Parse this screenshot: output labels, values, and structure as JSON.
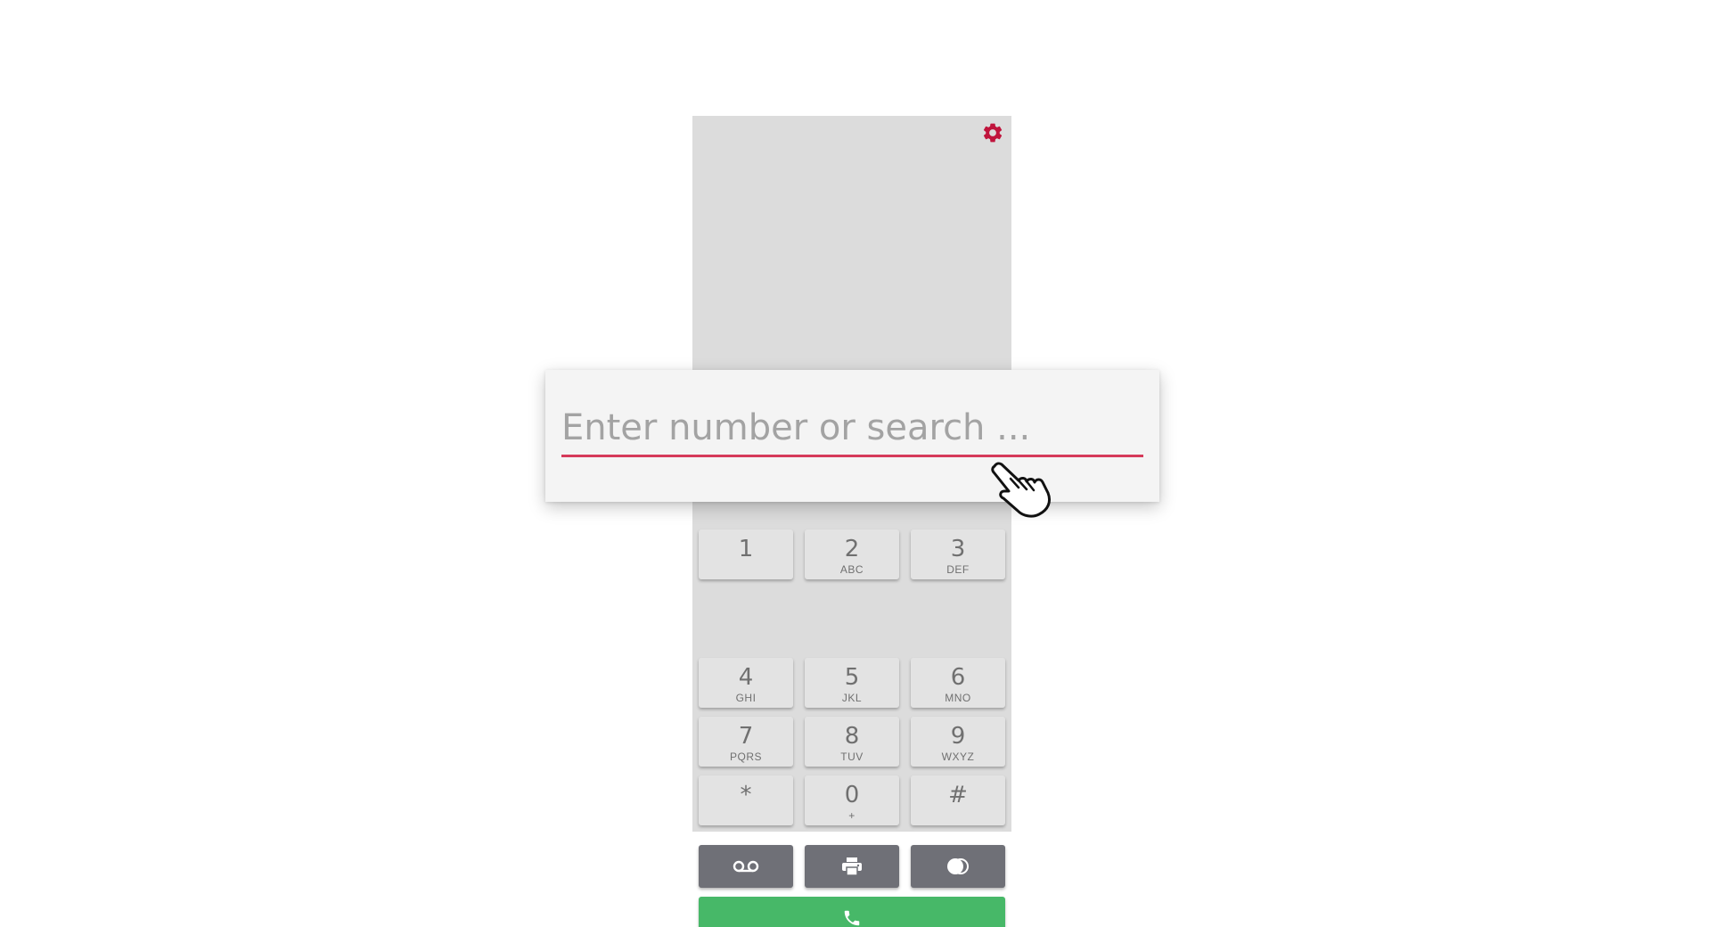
{
  "search": {
    "placeholder": "Enter number or search ..."
  },
  "keypad": {
    "keys": [
      {
        "digit": "1",
        "letters": ""
      },
      {
        "digit": "2",
        "letters": "ABC"
      },
      {
        "digit": "3",
        "letters": "DEF"
      },
      {
        "digit": "4",
        "letters": "GHI"
      },
      {
        "digit": "5",
        "letters": "JKL"
      },
      {
        "digit": "6",
        "letters": "MNO"
      },
      {
        "digit": "7",
        "letters": "PQRS"
      },
      {
        "digit": "8",
        "letters": "TUV"
      },
      {
        "digit": "9",
        "letters": "WXYZ"
      },
      {
        "digit": "*",
        "letters": ""
      },
      {
        "digit": "0",
        "letters": "+"
      },
      {
        "digit": "#",
        "letters": ""
      }
    ]
  },
  "function_buttons": [
    {
      "icon": "voicemail-icon"
    },
    {
      "icon": "fax-printer-icon"
    },
    {
      "icon": "toggle-icon"
    }
  ],
  "call_button": {
    "icon": "phone-icon"
  },
  "settings": {
    "icon": "gear-icon"
  },
  "colors": {
    "accent": "#c0143c",
    "input_underline": "#d63a5a",
    "call_green": "#47b868",
    "function_gray": "#6f7077",
    "panel_gray": "#dcdcdc"
  }
}
